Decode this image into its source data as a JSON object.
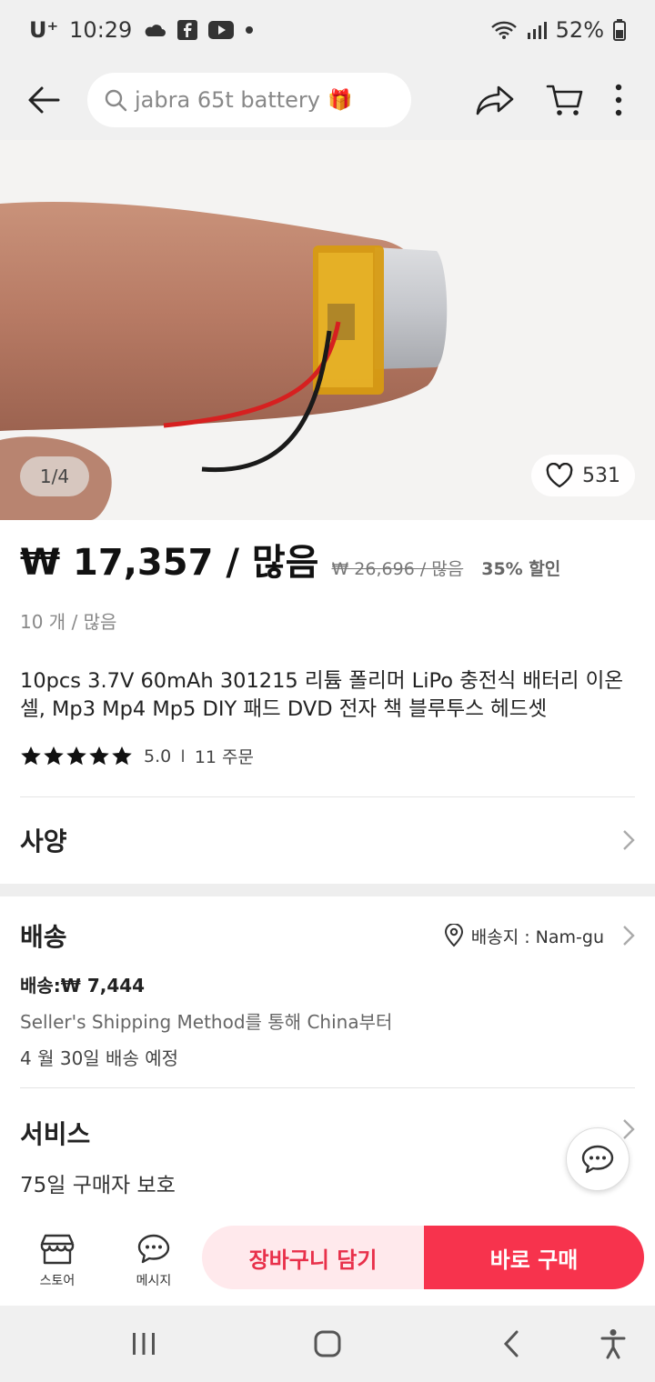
{
  "status_bar": {
    "carrier": "U⁺",
    "time": "10:29",
    "battery": "52%"
  },
  "search": {
    "query": "jabra 65t battery",
    "gift_emoji": "🎁"
  },
  "gallery": {
    "pager": "1/4",
    "likes": "531"
  },
  "price": {
    "current": "₩ 17,357 / 많음",
    "original": "₩ 26,696 / 많음",
    "discount": "35% 할인",
    "quantity": "10 개 / 많음"
  },
  "product": {
    "title": "10pcs 3.7V 60mAh 301215 리튬 폴리머 LiPo 충전식 배터리 이온 셀, Mp3 Mp4 Mp5 DIY 패드 DVD 전자 책 블루투스 헤드셋",
    "rating_value": "5.0",
    "separator": "I",
    "orders": "11 주문"
  },
  "spec": {
    "label": "사양"
  },
  "shipping": {
    "label": "배송",
    "destination": "배송지 : Nam-gu",
    "fee": "배송:₩ 7,444",
    "method": "Seller's Shipping Method를 통해 China부터",
    "eta": "4 월 30일 배송 예정"
  },
  "service": {
    "label": "서비스",
    "protection": "75일 구매자 보호"
  },
  "bottom_bar": {
    "store_label": "스토어",
    "message_label": "메시지",
    "add_to_cart": "장바구니 담기",
    "buy_now": "바로 구매"
  },
  "colors": {
    "accent": "#f7334d",
    "accent_light": "#ffe9ec"
  }
}
